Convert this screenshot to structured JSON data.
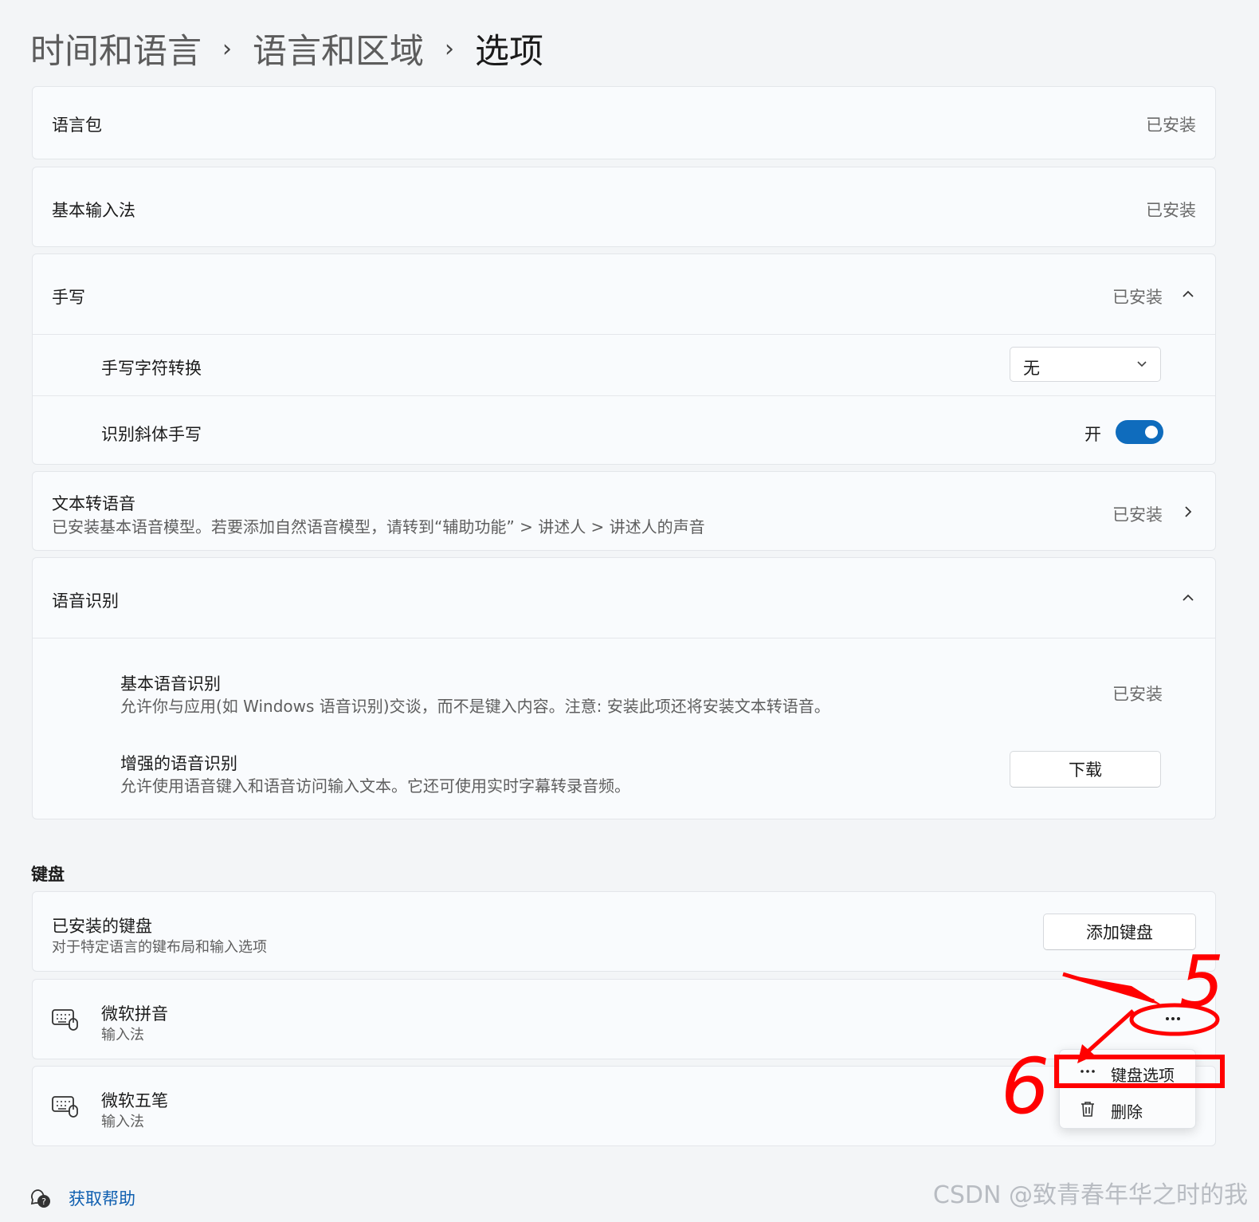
{
  "breadcrumb": {
    "level1": "时间和语言",
    "level2": "语言和区域",
    "current": "选项",
    "separator": "›"
  },
  "language_pack": {
    "label": "语言包",
    "status": "已安装"
  },
  "basic_typing": {
    "label": "基本输入法",
    "status": "已安装"
  },
  "handwriting": {
    "label": "手写",
    "status": "已安装",
    "char_conversion": {
      "label": "手写字符转换",
      "value": "无"
    },
    "italic": {
      "label": "识别斜体手写",
      "state_label": "开",
      "enabled": true
    }
  },
  "tts": {
    "label": "文本转语音",
    "description": "已安装基本语音模型。若要添加自然语音模型，请转到“辅助功能” > 讲述人 > 讲述人的声音",
    "status": "已安装"
  },
  "speech_recognition": {
    "label": "语音识别",
    "basic": {
      "label": "基本语音识别",
      "description": "允许你与应用(如 Windows 语音识别)交谈，而不是键入内容。注意: 安装此项还将安装文本转语音。",
      "status": "已安装"
    },
    "enhanced": {
      "label": "增强的语音识别",
      "description": "允许使用语音键入和语音访问输入文本。它还可使用实时字幕转录音频。",
      "button": "下载"
    }
  },
  "keyboard_section": {
    "title": "键盘",
    "installed": {
      "label": "已安装的键盘",
      "description": "对于特定语言的键布局和输入选项",
      "add_button": "添加键盘"
    },
    "items": [
      {
        "name": "微软拼音",
        "type": "输入法",
        "icon": "keyboard-icon"
      },
      {
        "name": "微软五笔",
        "type": "输入法",
        "icon": "keyboard-icon"
      }
    ],
    "more_button": "···",
    "menu": {
      "options": {
        "label": "键盘选项",
        "icon": "more-dots-icon"
      },
      "delete": {
        "label": "删除",
        "icon": "trash-icon"
      }
    }
  },
  "help": {
    "label": "获取帮助",
    "icon": "help-icon"
  },
  "watermark": "CSDN @致青春年华之时的我",
  "annotations": {
    "step5": "5",
    "step6": "6",
    "color": "#ff0000"
  },
  "colors": {
    "accent": "#0f6cbd",
    "link": "#0f5fb0",
    "annotation": "#ff0000"
  }
}
